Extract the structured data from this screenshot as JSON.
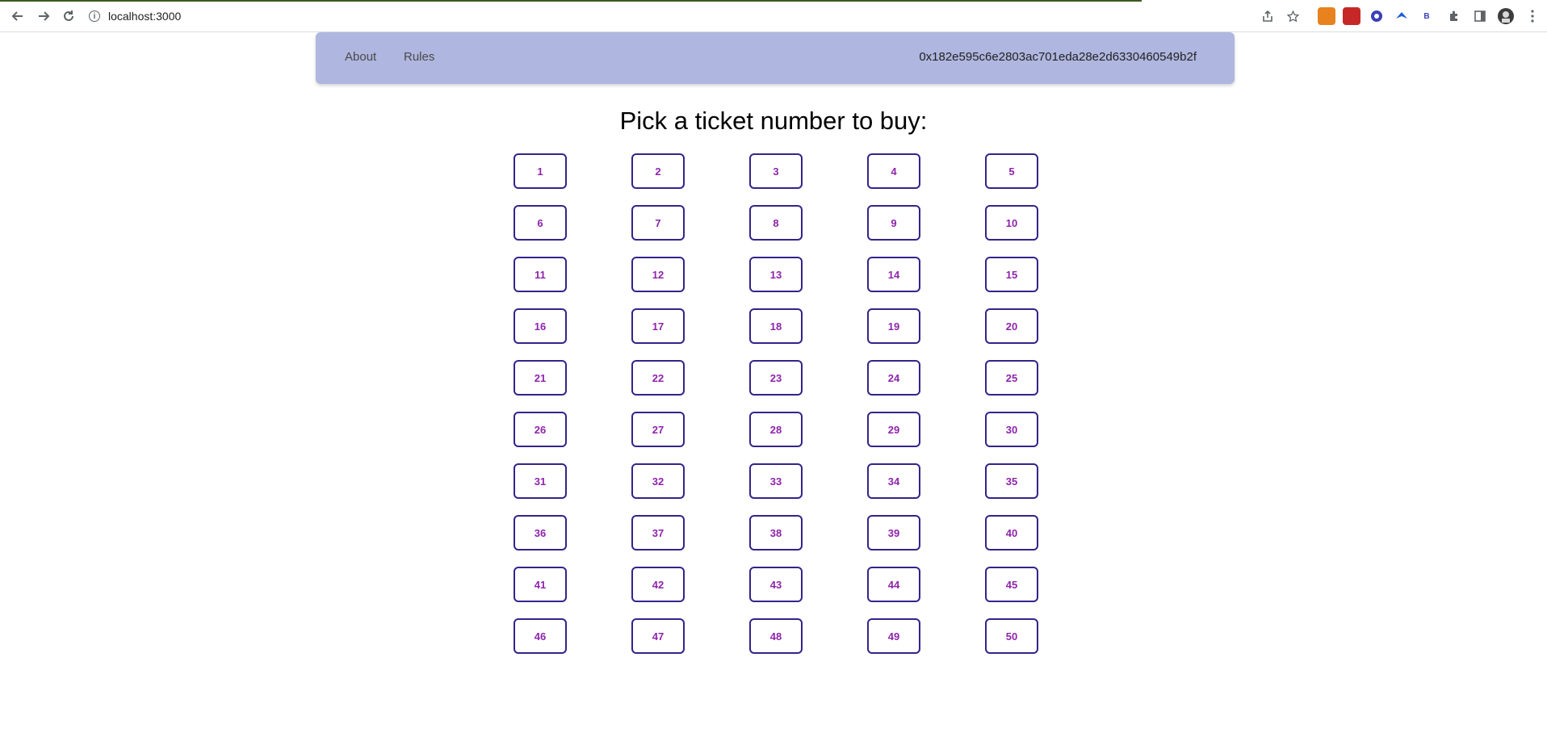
{
  "browser": {
    "url": "localhost:3000",
    "info_glyph": "i",
    "icons": {
      "back": "back-arrow-icon",
      "forward": "forward-arrow-icon",
      "reload": "reload-icon",
      "share": "share-icon",
      "bookmark": "star-icon",
      "extensions": "puzzle-icon",
      "side_panel": "side-panel-icon",
      "menu": "kebab-menu-icon"
    },
    "ext_badge": "B"
  },
  "app": {
    "nav": {
      "about": "About",
      "rules": "Rules"
    },
    "account": "0x182e595c6e2803ac701eda28e2d6330460549b2f"
  },
  "page": {
    "heading": "Pick a ticket number to buy:"
  },
  "tickets": [
    "1",
    "2",
    "3",
    "4",
    "5",
    "6",
    "7",
    "8",
    "9",
    "10",
    "11",
    "12",
    "13",
    "14",
    "15",
    "16",
    "17",
    "18",
    "19",
    "20",
    "21",
    "22",
    "23",
    "24",
    "25",
    "26",
    "27",
    "28",
    "29",
    "30",
    "31",
    "32",
    "33",
    "34",
    "35",
    "36",
    "37",
    "38",
    "39",
    "40",
    "41",
    "42",
    "43",
    "44",
    "45",
    "46",
    "47",
    "48",
    "49",
    "50"
  ],
  "colors": {
    "app_bar": "#afb6df",
    "ticket_border": "#33248a",
    "ticket_text": "#8e24aa",
    "progress": "#3b5a1f"
  }
}
